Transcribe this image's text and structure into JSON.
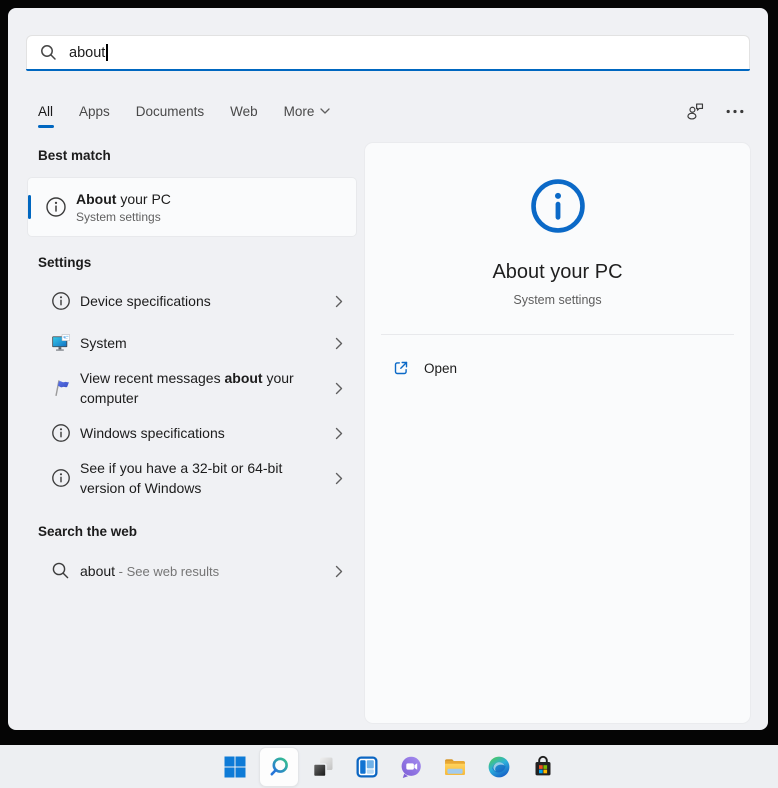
{
  "accent": "#0067c0",
  "search": {
    "value": "about"
  },
  "tabs": {
    "items": [
      "All",
      "Apps",
      "Documents",
      "Web",
      "More"
    ],
    "selected": "All"
  },
  "header_icons": [
    "user-chat-icon",
    "ellipsis-icon"
  ],
  "sections": {
    "best_match": {
      "label": "Best match",
      "item": {
        "icon": "info-circle-icon",
        "title_bold": "About",
        "title_rest": " your PC",
        "subtitle": "System settings"
      }
    },
    "settings": {
      "label": "Settings",
      "items": [
        {
          "icon": "info-circle-icon",
          "pre": "Device specifications",
          "bold": "",
          "post": ""
        },
        {
          "icon": "system-monitor-icon",
          "pre": "System",
          "bold": "",
          "post": ""
        },
        {
          "icon": "flag-icon",
          "pre": "View recent messages ",
          "bold": "about",
          "post": " your computer"
        },
        {
          "icon": "info-circle-icon",
          "pre": "Windows specifications",
          "bold": "",
          "post": ""
        },
        {
          "icon": "info-circle-icon",
          "pre": "See if you have a 32-bit or 64-bit version of Windows",
          "bold": "",
          "post": ""
        }
      ]
    },
    "web": {
      "label": "Search the web",
      "item": {
        "icon": "search-icon",
        "query": "about",
        "suffix": " - See web results"
      }
    }
  },
  "preview": {
    "icon": "info-circle-icon",
    "title": "About your PC",
    "subtitle": "System settings",
    "open_label": "Open"
  },
  "taskbar": {
    "active": "search",
    "items": [
      "start",
      "search",
      "task-view",
      "widgets",
      "chat",
      "file-explorer",
      "edge",
      "store"
    ]
  }
}
